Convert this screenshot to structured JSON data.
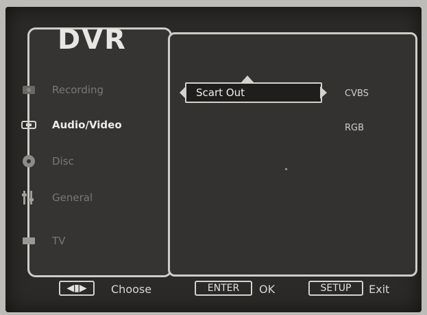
{
  "title": "DVR",
  "menu": [
    {
      "label": "Recording",
      "icon": "record-icon"
    },
    {
      "label": "Audio/Video",
      "icon": "audio-video-icon",
      "active": true
    },
    {
      "label": "Disc",
      "icon": "disc-icon"
    },
    {
      "label": "General",
      "icon": "general-icon"
    },
    {
      "label": "TV",
      "icon": "tv-icon"
    }
  ],
  "setting": {
    "label": "Scart Out"
  },
  "options": [
    "CVBS",
    "RGB"
  ],
  "footer": {
    "choose_key": "◀▮▶",
    "choose_label": "Choose",
    "enter_key": "ENTER",
    "enter_label": "OK",
    "setup_key": "SETUP",
    "setup_label": "Exit"
  }
}
